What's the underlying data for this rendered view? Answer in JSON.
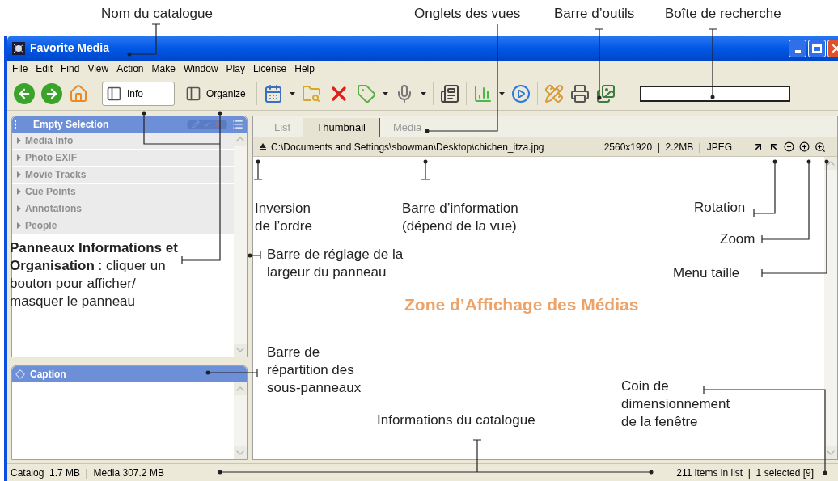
{
  "annotations": [
    {
      "kind": "callout",
      "text": "Nom du catalogue"
    },
    {
      "kind": "callout",
      "text": "Onglets des vues"
    },
    {
      "kind": "callout",
      "text": "Barre d’outils"
    },
    {
      "kind": "callout",
      "text": "Boîte de recherche"
    },
    {
      "kind": "callout",
      "text": "Inversion\nde l’ordre"
    },
    {
      "kind": "callout",
      "text": "Barre d’information\n(dépend de la vue)"
    },
    {
      "kind": "callout",
      "text": "Rotation"
    },
    {
      "kind": "callout",
      "text": "Zoom"
    },
    {
      "kind": "callout",
      "text": "**Panneaux Informations et Organisation** : cliquer un bouton pour afficher/ masquer le panneau"
    },
    {
      "kind": "callout",
      "text": "Barre de réglage de la\nlargeur du panneau"
    },
    {
      "kind": "callout",
      "text": "Menu taille"
    },
    {
      "kind": "zone",
      "text": "Zone d’Affichage des Médias"
    },
    {
      "kind": "callout",
      "text": "Barre de\nrépartition des\nsous-panneaux"
    },
    {
      "kind": "callout",
      "text": "Informations du catalogue"
    },
    {
      "kind": "callout",
      "text": "Coin de\ndimensionnement\nde la fenêtre"
    }
  ],
  "window": {
    "title": "Favorite Media"
  },
  "menu": [
    "File",
    "Edit",
    "Find",
    "View",
    "Action",
    "Make",
    "Window",
    "Play",
    "License",
    "Help"
  ],
  "toolbar": {
    "panel_buttons": [
      {
        "label": "Info",
        "selected": true
      },
      {
        "label": "Organize",
        "selected": false
      }
    ]
  },
  "info_panel": {
    "title": "Empty Selection",
    "items": [
      {
        "label": "Media Info",
        "disabled": true
      },
      {
        "label": "Photo EXIF",
        "disabled": true
      },
      {
        "label": "Movie Tracks",
        "disabled": true
      },
      {
        "label": "Cue Points",
        "disabled": true
      },
      {
        "label": "Annotations",
        "disabled": true
      },
      {
        "label": "People",
        "disabled": true
      }
    ]
  },
  "caption_panel": {
    "title": "Caption"
  },
  "view_tabs": [
    {
      "label": "List",
      "selected": false
    },
    {
      "label": "Thumbnail",
      "selected": true
    },
    {
      "label": "Media",
      "selected": false
    }
  ],
  "info_bar": {
    "path": "C:\\Documents and Settings\\sbowman\\Desktop\\chichen_itza.jpg",
    "details": "2560x1920  |  2.2MB  |  JPEG"
  },
  "status_bar": {
    "left": "Catalog  1.7 MB  |  Media 307.2 MB",
    "right": "211 items in list  |  1 selected [9]"
  }
}
